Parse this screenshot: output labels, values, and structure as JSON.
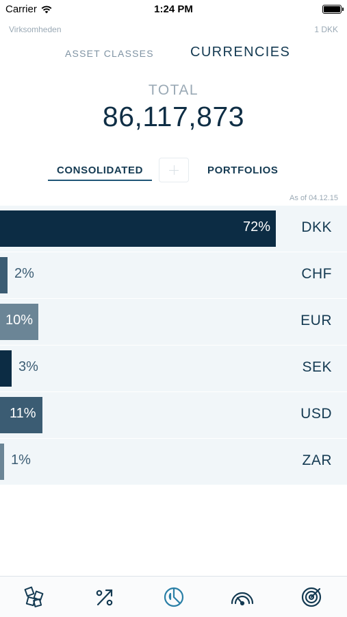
{
  "status": {
    "carrier": "Carrier",
    "time": "1:24 PM"
  },
  "header": {
    "company": "Virksomheden",
    "unit": "1 DKK"
  },
  "tabs": {
    "asset_classes": "ASSET CLASSES",
    "currencies": "CURRENCIES"
  },
  "total": {
    "label": "TOTAL",
    "value": "86,117,873"
  },
  "segments": {
    "consolidated": "CONSOLIDATED",
    "portfolios": "PORTFOLIOS"
  },
  "as_of": "As of 04.12.15",
  "colors": {
    "accent": "#1f5677",
    "dark": "#0f2e45",
    "mid": "#3b5c73",
    "light": "#6b8596",
    "row_bg": "#f1f6f9"
  },
  "currencies": [
    {
      "code": "DKK",
      "pct_label": "72%",
      "share": 0.72,
      "color": "#0c2c44"
    },
    {
      "code": "CHF",
      "pct_label": "2%",
      "share": 0.02,
      "color": "#3b5c73"
    },
    {
      "code": "EUR",
      "pct_label": "10%",
      "share": 0.1,
      "color": "#6b8596"
    },
    {
      "code": "SEK",
      "pct_label": "3%",
      "share": 0.03,
      "color": "#0c2c44"
    },
    {
      "code": "USD",
      "pct_label": "11%",
      "share": 0.11,
      "color": "#3b5c73"
    },
    {
      "code": "ZAR",
      "pct_label": "1%",
      "share": 0.01,
      "color": "#6b8596"
    }
  ],
  "tab_bar": [
    {
      "name": "overview-icon",
      "active": false
    },
    {
      "name": "percent-icon",
      "active": false
    },
    {
      "name": "pie-chart-icon",
      "active": true
    },
    {
      "name": "gauge-icon",
      "active": false
    },
    {
      "name": "target-icon",
      "active": false
    }
  ]
}
